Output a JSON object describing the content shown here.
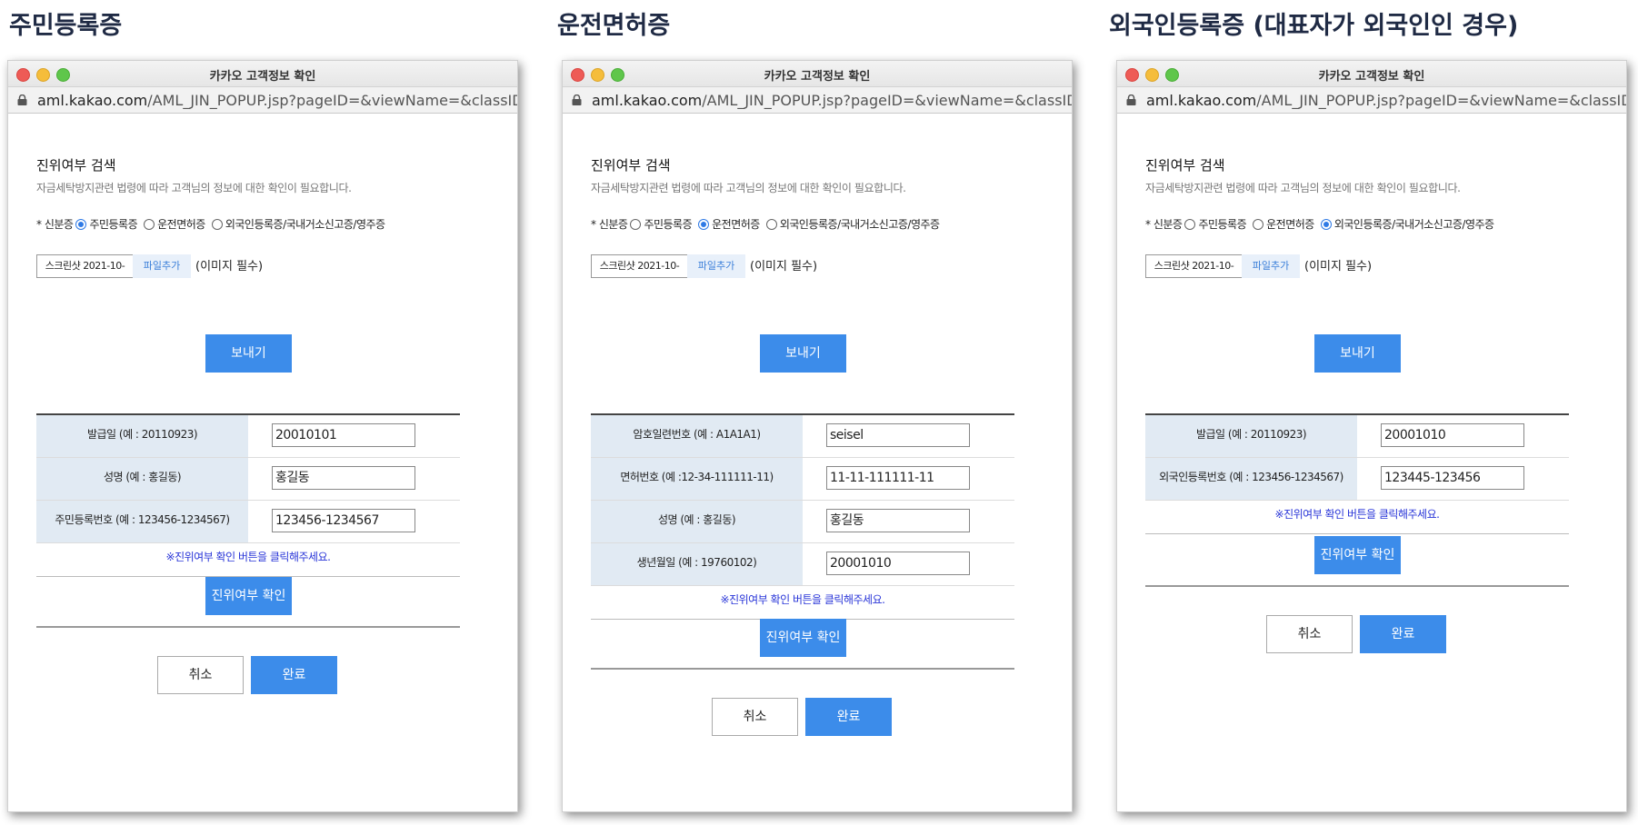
{
  "headings": [
    "주민등록증",
    "운전면허증",
    "외국인등록증 (대표자가 외국인인 경우)"
  ],
  "window": {
    "title": "카카오 고객정보 확인",
    "url_domain": "aml.kakao.com",
    "url_path": "/AML_JIN_POPUP.jsp?pageID=&viewName=&classID=&..."
  },
  "form": {
    "section_title": "진위여부 검색",
    "description": "자금세탁방지관련 법령에 따라 고객님의 정보에 대한 확인이 필요합니다.",
    "id_label": "* 신분증",
    "id_options": [
      "주민등록증",
      "운전면허증",
      "외국인등록증/국내거소신고증/영주증"
    ],
    "file_name": "스크린샷 2021-10-",
    "add_file": "파일추가",
    "image_required": "(이미지 필수)",
    "send_button": "보내기",
    "note": "※진위여부 확인 버튼을 클릭해주세요.",
    "verify_button": "진위여부 확인",
    "cancel_button": "취소",
    "done_button": "완료"
  },
  "panels": [
    {
      "selected": 0,
      "rows": [
        {
          "label": "발급일 (예 : 20110923)",
          "value": "20010101"
        },
        {
          "label": "성명 (예 : 홍길동)",
          "value": "홍길동"
        },
        {
          "label": "주민등록번호 (예 : 123456-1234567)",
          "value": "123456-1234567"
        }
      ]
    },
    {
      "selected": 1,
      "rows": [
        {
          "label": "암호일련번호 (예 : A1A1A1)",
          "value": "seisel"
        },
        {
          "label": "면허번호 (예 :12-34-111111-11)",
          "value": "11-11-111111-11"
        },
        {
          "label": "성명 (예 : 홍길동)",
          "value": "홍길동"
        },
        {
          "label": "생년월일 (예 : 19760102)",
          "value": "20001010"
        }
      ]
    },
    {
      "selected": 2,
      "rows": [
        {
          "label": "발급일 (예 : 20110923)",
          "value": "20001010"
        },
        {
          "label": "외국인등록번호 (예 : 123456-1234567)",
          "value": "123445-123456"
        }
      ]
    }
  ],
  "colors": {
    "accent": "#3c8cea",
    "note": "#2a36d8",
    "table_label_bg": "#e1eaf3"
  }
}
